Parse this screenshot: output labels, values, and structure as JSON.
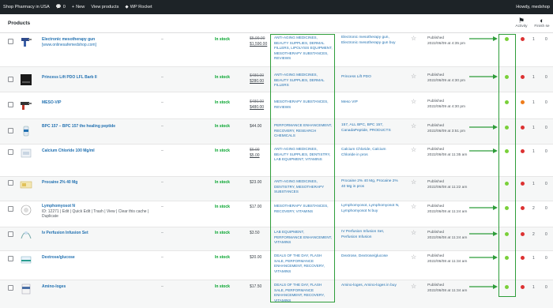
{
  "adminbar": {
    "site_title": "Shop Pharmacy in USA",
    "comments_count": "0",
    "new_label": "New",
    "view_products_label": "View products",
    "wp_rocket_label": "WP Rocket",
    "greeting": "Howdy, medshop"
  },
  "header": {
    "page_title": "Products",
    "activity_label": "Activity",
    "finish_setup_label": "Finish se"
  },
  "rows": [
    {
      "name": "Electronic mesotherapy gun",
      "sub": "[www.onlinesafemedshop.com]",
      "sku": "–",
      "stock": "In stock",
      "price_old": "$5,99.00",
      "price_new": "$1,590.00",
      "categories": "ANTI-AGING MEDICINES, BEAUTY SUPPLIES, DERMAL FILLERS, Lipolysis equipment, MESOTHERAPY SUBSTANCES, REVIEWS",
      "tags": "Electronic mesotherapy gun, Electronic mesotherapy gun buy",
      "status": "Published",
      "date": "2022/06/09 at 4:35 pm",
      "count": "1",
      "dash": "0"
    },
    {
      "name": "Princess Lift PDO LFL Barb II",
      "sku": "–",
      "stock": "In stock",
      "price_old": "$480.00",
      "price_new": "$280.00",
      "categories": "ANTI-AGING MEDICINES, BEAUTY SUPPLIES, DERMAL FILLERS",
      "tags": "Princess Lift PDO",
      "status": "Published",
      "date": "2022/06/09 at 4:30 pm",
      "count": "1",
      "dash": "0"
    },
    {
      "name": "MESO-VIP",
      "sku": "–",
      "stock": "In stock",
      "price_old": "$480.00",
      "price_new": "$480.00",
      "categories": "MESOTHERAPY SUBSTANCES, REVIEWS",
      "tags": "Meso VIP",
      "status": "Published",
      "date": "2022/06/09 at 4:30 pm",
      "count": "1",
      "dash": "0"
    },
    {
      "name": "BPC 157 – BPC 157 the healing peptide",
      "sku": "–",
      "stock": "In stock",
      "price": "$44.00",
      "categories": "PERFORMANCE ENHANCEMENT, Recovery, RESEARCH CHEMICALS",
      "tags": "157, ALL BPC, BPC 157, CanadaPeptide, PRODUCTS",
      "status": "Published",
      "date": "2022/06/09 at 3:51 pm",
      "count": "1",
      "dash": "0"
    },
    {
      "name": "Calcium Chloride 100 Mg/ml",
      "sku": "–",
      "stock": "In stock",
      "price_old": "$6.00",
      "price_new": "$5.00",
      "categories": "ANTI-AGING MEDICINES, BEAUTY SUPPLIES, DENTISTRY, LAB EQUIPMENT, VITAMINS",
      "tags": "Calcium Chloride, Calcium Chloride in pros",
      "status": "Published",
      "date": "2022/06/08 at 11:35 am",
      "count": "1",
      "dash": "0"
    },
    {
      "name": "Procaine 2% 40 Mg",
      "sku": "–",
      "stock": "In stock",
      "price": "$23.00",
      "categories": "ANTI-AGING MEDICINES, DENTISTRY, MESOTHERAPY SUBSTANCES",
      "tags": "Procaine 2% 40 Mg, Procaine 2% 40 Mg in pros",
      "status": "Published",
      "date": "2022/06/08 at 11:22 am",
      "count": "1",
      "dash": "0"
    },
    {
      "name": "Lymphomyosot N",
      "sub_links": "ID: 12271 | Edit | Quick Edit | Trash | View | Clear this cache | Duplicate",
      "sku": "–",
      "stock": "In stock",
      "price": "$17.00",
      "categories": "MESOTHERAPY SUBSTANCES, RECOVERY, VITAMINS",
      "tags": "Lymphomyosot, Lymphomyosot N, Lymphomyosot N buy",
      "status": "Published",
      "date": "2022/06/08 at 11:24 am",
      "count": "2",
      "dash": "0"
    },
    {
      "name": "Iv Perfusion Infusion Set",
      "sku": "–",
      "stock": "In stock",
      "price": "$3.50",
      "categories": "LAB EQUIPMENT, PERFORMANCE ENHANCEMENT, VITAMINS",
      "tags": "IV Perfusion Infusion Set, Perfusion Infusion",
      "status": "Published",
      "date": "2022/06/08 at 11:24 am",
      "count": "2",
      "dash": "0"
    },
    {
      "name": "Dextrose/glucose",
      "sku": "–",
      "stock": "In stock",
      "price": "$20.00",
      "categories": "Deals of the day, FLASH SALE, PERFORMANCE ENHANCEMENT, RECOVERY, VITAMINS",
      "tags": "Dextrose, Dextrose/glucose",
      "status": "Published",
      "date": "2022/06/08 at 11:34 am",
      "count": "1",
      "dash": "0"
    },
    {
      "name": "Amino-loges",
      "sku": "–",
      "stock": "In stock",
      "price": "$17.50",
      "categories": "Deals of the day, FLASH SALE, PERFORMANCE ENHANCEMENT, RECOVERY, VITAMINS",
      "tags": "Amino-loges, Amino-loges in buy",
      "status": "Published",
      "date": "2022/06/08 at 11:34 am",
      "count": "1",
      "dash": "0"
    }
  ],
  "colors": {
    "accent": "#2271b1",
    "in_stock": "#00a32a",
    "status_green": "#7ad03a",
    "status_red": "#dc3232",
    "highlight": "#2e9d3a"
  },
  "icons": [
    "wordpress-icon",
    "home-icon",
    "comment-icon",
    "plus-icon",
    "rocket-icon",
    "flag-icon",
    "half-circle-icon",
    "star-icon"
  ]
}
